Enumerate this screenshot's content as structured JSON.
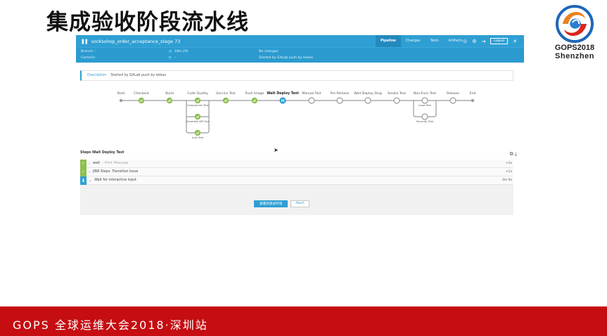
{
  "slide": {
    "title": "集成验收阶段流水线"
  },
  "logo": {
    "line1": "GOPS2018",
    "line2": "Shenzhen"
  },
  "topbar": {
    "run_title": "socksshop_order_acceptance_stage 73",
    "tabs": [
      {
        "label": "Pipeline",
        "active": true
      },
      {
        "label": "Changes",
        "active": false
      },
      {
        "label": "Tests",
        "active": false
      },
      {
        "label": "Artifacts",
        "active": false
      }
    ],
    "logout_label": "Logout",
    "icons": [
      "play-icon",
      "gear-icon",
      "exit-icon",
      "close-icon"
    ]
  },
  "info": {
    "branch_label": "Branch:",
    "branch_value": "–",
    "commit_label": "Commit:",
    "commit_value": "–",
    "duration": "18m 2%",
    "time": "–",
    "changes": "No changes",
    "started": "Started by GitLab push by leibao"
  },
  "description": {
    "label": "Description",
    "text": "Started by GitLab push by leibao"
  },
  "pipeline": {
    "stages": [
      {
        "name": "Start",
        "status": "start"
      },
      {
        "name": "Checkout",
        "status": "success"
      },
      {
        "name": "Build",
        "status": "success"
      },
      {
        "name": "Code Quality",
        "status": "success"
      },
      {
        "name": "Service Test",
        "status": "success"
      },
      {
        "name": "Push Image",
        "status": "success"
      },
      {
        "name": "Wait Deploy Test",
        "status": "running"
      },
      {
        "name": "Manual Test",
        "status": "pending"
      },
      {
        "name": "Pre Release",
        "status": "pending"
      },
      {
        "name": "Wait Deploy Stag",
        "status": "pending"
      },
      {
        "name": "Smoke Test",
        "status": "pending"
      },
      {
        "name": "Non-Func Test",
        "status": "pending"
      },
      {
        "name": "Release",
        "status": "pending"
      },
      {
        "name": "End",
        "status": "end"
      }
    ],
    "code_quality_parallel": [
      "Component Test",
      "Generate API Doc",
      "Unit Test"
    ],
    "nonfunc_parallel": [
      "Load Test",
      "Security Test"
    ]
  },
  "steps": {
    "header": "Steps Wait Deploy Test",
    "items": [
      {
        "status": "success",
        "label": "wait",
        "sub": "– Print Message",
        "duration": "<1s",
        "expanded": false
      },
      {
        "status": "success",
        "label": "JIRA Steps: Transition Issue",
        "sub": "",
        "duration": "<1s",
        "expanded": false
      },
      {
        "status": "running",
        "label": "Wait for interactive input",
        "sub": "",
        "duration": "3m 9s",
        "expanded": true
      }
    ],
    "proceed_label": "部署到测试环境",
    "abort_label": "Abort"
  },
  "colors": {
    "primary": "#2f9fd3",
    "success": "#8cc04f",
    "footer": "#c50d12"
  },
  "footer": {
    "text": "GOPS 全球运维大会2018·深圳站"
  }
}
